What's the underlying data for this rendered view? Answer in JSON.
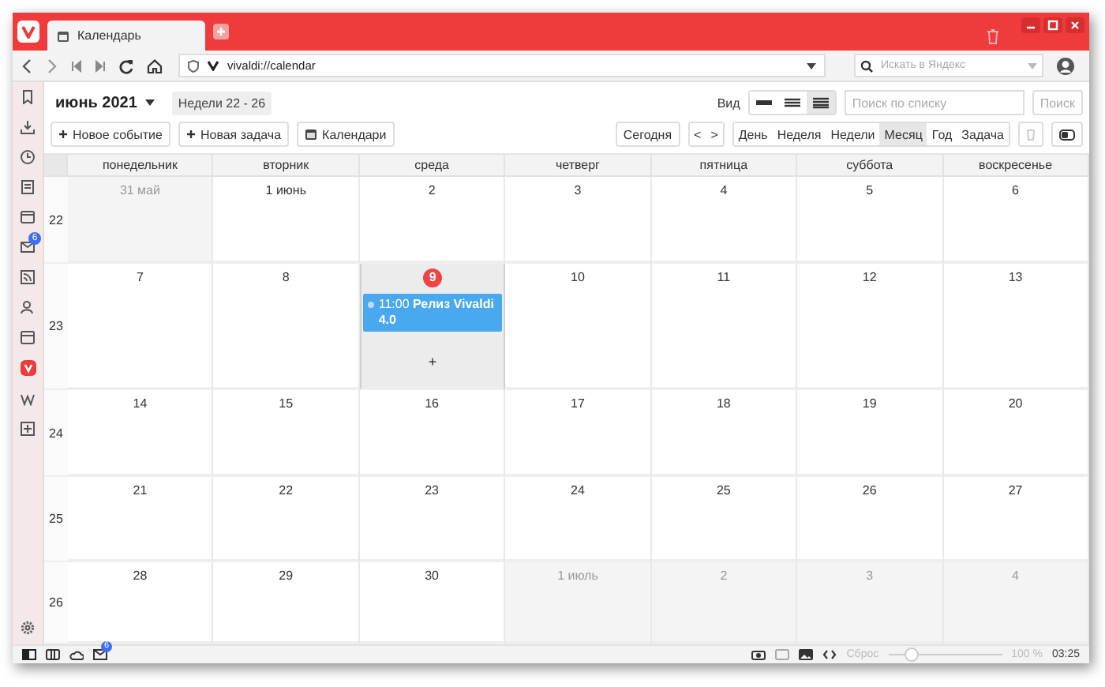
{
  "tab": {
    "title": "Календарь"
  },
  "address": {
    "url": "vivaldi://calendar"
  },
  "search_engine": {
    "placeholder": "Искать в Яндекс"
  },
  "sidebar": {
    "mail_badge": "6"
  },
  "calendar": {
    "month_title": "июнь 2021",
    "weeks_range": "Недели 22 - 26",
    "actions": [
      "Новое событие",
      "Новая задача",
      "Календари"
    ],
    "view_label": "Вид",
    "density": [
      {
        "selected": false
      },
      {
        "selected": false
      },
      {
        "selected": true
      }
    ],
    "list_search": {
      "placeholder": "Поиск по списку"
    },
    "search_button": "Поиск",
    "today_button": "Сегодня",
    "prev_label": "<",
    "next_label": ">",
    "views": [
      {
        "label": "День",
        "selected": false
      },
      {
        "label": "Неделя",
        "selected": false
      },
      {
        "label": "Недели",
        "selected": false
      },
      {
        "label": "Месяц",
        "selected": true
      },
      {
        "label": "Год",
        "selected": false
      },
      {
        "label": "Задача",
        "selected": false
      }
    ],
    "weekdays": [
      "понедельник",
      "вторник",
      "среда",
      "четверг",
      "пятница",
      "суббота",
      "воскресенье"
    ],
    "weeks": [
      {
        "number": "22",
        "days": [
          {
            "label": "31 май",
            "other_month": true,
            "today": false,
            "selected": false
          },
          {
            "label": "1 июнь",
            "other_month": false,
            "today": false,
            "selected": false
          },
          {
            "label": "2",
            "other_month": false,
            "today": false,
            "selected": false
          },
          {
            "label": "3",
            "other_month": false,
            "today": false,
            "selected": false
          },
          {
            "label": "4",
            "other_month": false,
            "today": false,
            "selected": false
          },
          {
            "label": "5",
            "other_month": false,
            "today": false,
            "selected": false
          },
          {
            "label": "6",
            "other_month": false,
            "today": false,
            "selected": false
          }
        ]
      },
      {
        "number": "23",
        "days": [
          {
            "label": "7",
            "other_month": false,
            "today": false,
            "selected": false
          },
          {
            "label": "8",
            "other_month": false,
            "today": false,
            "selected": false
          },
          {
            "label": "9",
            "other_month": false,
            "today": true,
            "selected": true,
            "events": [
              {
                "text": "11:00 **Релиз Vivaldi 4.0**"
              }
            ],
            "add_label": "+"
          },
          {
            "label": "10",
            "other_month": false,
            "today": false,
            "selected": false
          },
          {
            "label": "11",
            "other_month": false,
            "today": false,
            "selected": false
          },
          {
            "label": "12",
            "other_month": false,
            "today": false,
            "selected": false
          },
          {
            "label": "13",
            "other_month": false,
            "today": false,
            "selected": false
          }
        ]
      },
      {
        "number": "24",
        "days": [
          {
            "label": "14",
            "other_month": false,
            "today": false,
            "selected": false
          },
          {
            "label": "15",
            "other_month": false,
            "today": false,
            "selected": false
          },
          {
            "label": "16",
            "other_month": false,
            "today": false,
            "selected": false
          },
          {
            "label": "17",
            "other_month": false,
            "today": false,
            "selected": false
          },
          {
            "label": "18",
            "other_month": false,
            "today": false,
            "selected": false
          },
          {
            "label": "19",
            "other_month": false,
            "today": false,
            "selected": false
          },
          {
            "label": "20",
            "other_month": false,
            "today": false,
            "selected": false
          }
        ]
      },
      {
        "number": "25",
        "days": [
          {
            "label": "21",
            "other_month": false,
            "today": false,
            "selected": false
          },
          {
            "label": "22",
            "other_month": false,
            "today": false,
            "selected": false
          },
          {
            "label": "23",
            "other_month": false,
            "today": false,
            "selected": false
          },
          {
            "label": "24",
            "other_month": false,
            "today": false,
            "selected": false
          },
          {
            "label": "25",
            "other_month": false,
            "today": false,
            "selected": false
          },
          {
            "label": "26",
            "other_month": false,
            "today": false,
            "selected": false
          },
          {
            "label": "27",
            "other_month": false,
            "today": false,
            "selected": false
          }
        ]
      },
      {
        "number": "26",
        "days": [
          {
            "label": "28",
            "other_month": false,
            "today": false,
            "selected": false
          },
          {
            "label": "29",
            "other_month": false,
            "today": false,
            "selected": false
          },
          {
            "label": "30",
            "other_month": false,
            "today": false,
            "selected": false
          },
          {
            "label": "1 июль",
            "other_month": true,
            "today": false,
            "selected": false
          },
          {
            "label": "2",
            "other_month": true,
            "today": false,
            "selected": false
          },
          {
            "label": "3",
            "other_month": true,
            "today": false,
            "selected": false
          },
          {
            "label": "4",
            "other_month": true,
            "today": false,
            "selected": false
          }
        ]
      }
    ]
  },
  "status_bar": {
    "mail_badge": "6",
    "reset_label": "Сброс",
    "zoom": {
      "level": 0.2
    },
    "zoom_reading": "100 %",
    "clock": "03:25"
  }
}
